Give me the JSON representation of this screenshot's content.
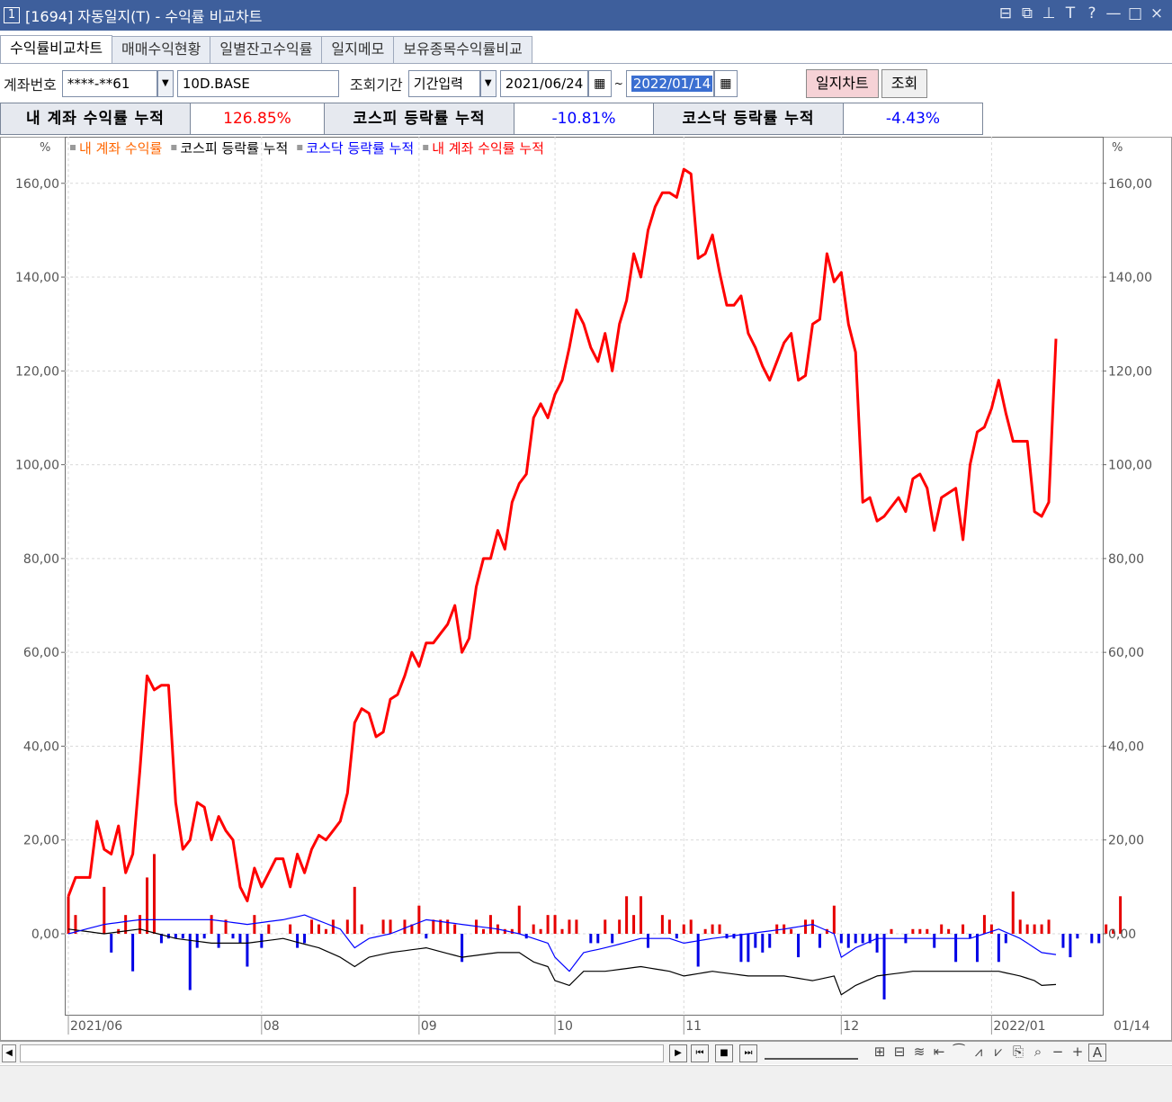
{
  "window": {
    "number": "1",
    "title": "[1694] 자동일지(T) - 수익률 비교차트",
    "tools": [
      "⊟",
      "⧉",
      "⊥",
      "T",
      "?",
      "—",
      "□",
      "×"
    ]
  },
  "tabs": [
    {
      "label": "수익률비교차트",
      "active": true
    },
    {
      "label": "매매수익현황",
      "active": false
    },
    {
      "label": "일별잔고수익률",
      "active": false
    },
    {
      "label": "일지메모",
      "active": false
    },
    {
      "label": "보유종목수익률비교",
      "active": false
    }
  ],
  "toolbar": {
    "account_label": "계좌번호",
    "account_value": "****-**61",
    "account_name": "10D.BASE",
    "period_label": "조회기간",
    "period_mode": "기간입력",
    "start_date": "2021/06/24",
    "tilde": "~",
    "end_date": "2022/01/14",
    "diary_chart_button": "일지차트",
    "query_button": "조회"
  },
  "summary": {
    "my_label": "내 계좌 수익률 누적",
    "my_value": "126.85%",
    "kospi_label": "코스피 등락률 누적",
    "kospi_value": "-10.81%",
    "kosdaq_label": "코스닥 등락률 누적",
    "kosdaq_value": "-4.43%"
  },
  "colors": {
    "my_account": "#ff0000",
    "my_bar_pos": "#e60000",
    "my_bar_neg": "#0000e6",
    "kospi": "#000000",
    "kosdaq": "#0000ff",
    "legend_orange": "#ff6600"
  },
  "chart_data": {
    "type": "line",
    "unit": "%",
    "legend": [
      {
        "name": "내 계좌 수익률",
        "color": "#ff6600",
        "kind": "bar"
      },
      {
        "name": "코스피 등락률 누적",
        "color": "#000000",
        "kind": "line"
      },
      {
        "name": "코스닥 등락률 누적",
        "color": "#0000ff",
        "kind": "line"
      },
      {
        "name": "내 계좌 수익률 누적",
        "color": "#ff0000",
        "kind": "line"
      }
    ],
    "y_ticks": [
      "0,00",
      "20,00",
      "40,00",
      "60,00",
      "80,00",
      "100,00",
      "120,00",
      "140,00",
      "160,00"
    ],
    "ylim": [
      -17,
      166
    ],
    "x_ticks": [
      {
        "label": "2021/06",
        "index": 0
      },
      {
        "label": "08",
        "index": 27
      },
      {
        "label": "09",
        "index": 49
      },
      {
        "label": "10",
        "index": 68
      },
      {
        "label": "11",
        "index": 86
      },
      {
        "label": "12",
        "index": 108
      },
      {
        "label": "2022/01",
        "index": 129
      },
      {
        "label": "01/14",
        "index": 138
      }
    ],
    "n": 139,
    "series": [
      {
        "name": "내 계좌 수익률 누적",
        "color": "#ff0000",
        "anchors": [
          [
            0,
            8
          ],
          [
            1,
            12
          ],
          [
            3,
            12
          ],
          [
            4,
            24
          ],
          [
            5,
            18
          ],
          [
            6,
            17
          ],
          [
            7,
            23
          ],
          [
            8,
            13
          ],
          [
            9,
            17
          ],
          [
            10,
            35
          ],
          [
            11,
            55
          ],
          [
            12,
            52
          ],
          [
            13,
            53
          ],
          [
            14,
            53
          ],
          [
            15,
            28
          ],
          [
            16,
            18
          ],
          [
            17,
            20
          ],
          [
            18,
            28
          ],
          [
            19,
            27
          ],
          [
            20,
            20
          ],
          [
            21,
            25
          ],
          [
            22,
            22
          ],
          [
            23,
            20
          ],
          [
            24,
            10
          ],
          [
            25,
            7
          ],
          [
            26,
            14
          ],
          [
            27,
            10
          ],
          [
            28,
            13
          ],
          [
            29,
            16
          ],
          [
            30,
            16
          ],
          [
            31,
            10
          ],
          [
            32,
            17
          ],
          [
            33,
            13
          ],
          [
            34,
            18
          ],
          [
            35,
            21
          ],
          [
            36,
            20
          ],
          [
            37,
            22
          ],
          [
            38,
            24
          ],
          [
            39,
            30
          ],
          [
            40,
            45
          ],
          [
            41,
            48
          ],
          [
            42,
            47
          ],
          [
            43,
            42
          ],
          [
            44,
            43
          ],
          [
            45,
            50
          ],
          [
            46,
            51
          ],
          [
            47,
            55
          ],
          [
            48,
            60
          ],
          [
            49,
            57
          ],
          [
            50,
            62
          ],
          [
            51,
            62
          ],
          [
            52,
            64
          ],
          [
            53,
            66
          ],
          [
            54,
            70
          ],
          [
            55,
            60
          ],
          [
            56,
            63
          ],
          [
            57,
            74
          ],
          [
            58,
            80
          ],
          [
            59,
            80
          ],
          [
            60,
            86
          ],
          [
            61,
            82
          ],
          [
            62,
            92
          ],
          [
            63,
            96
          ],
          [
            64,
            98
          ],
          [
            65,
            110
          ],
          [
            66,
            113
          ],
          [
            67,
            110
          ],
          [
            68,
            115
          ],
          [
            69,
            118
          ],
          [
            70,
            125
          ],
          [
            71,
            133
          ],
          [
            72,
            130
          ],
          [
            73,
            125
          ],
          [
            74,
            122
          ],
          [
            75,
            128
          ],
          [
            76,
            120
          ],
          [
            77,
            130
          ],
          [
            78,
            135
          ],
          [
            79,
            145
          ],
          [
            80,
            140
          ],
          [
            81,
            150
          ],
          [
            82,
            155
          ],
          [
            83,
            158
          ],
          [
            84,
            158
          ],
          [
            85,
            157
          ],
          [
            86,
            163
          ],
          [
            87,
            162
          ],
          [
            88,
            144
          ],
          [
            89,
            145
          ],
          [
            90,
            149
          ],
          [
            91,
            141
          ],
          [
            92,
            134
          ],
          [
            93,
            134
          ],
          [
            94,
            136
          ],
          [
            95,
            128
          ],
          [
            96,
            125
          ],
          [
            97,
            121
          ],
          [
            98,
            118
          ],
          [
            99,
            122
          ],
          [
            100,
            126
          ],
          [
            101,
            128
          ],
          [
            102,
            118
          ],
          [
            103,
            119
          ],
          [
            104,
            130
          ],
          [
            105,
            131
          ],
          [
            106,
            145
          ],
          [
            107,
            139
          ],
          [
            108,
            141
          ],
          [
            109,
            130
          ],
          [
            110,
            124
          ],
          [
            111,
            92
          ],
          [
            112,
            93
          ],
          [
            113,
            88
          ],
          [
            114,
            89
          ],
          [
            115,
            91
          ],
          [
            116,
            93
          ],
          [
            117,
            90
          ],
          [
            118,
            97
          ],
          [
            119,
            98
          ],
          [
            120,
            95
          ],
          [
            121,
            86
          ],
          [
            122,
            93
          ],
          [
            123,
            94
          ],
          [
            124,
            95
          ],
          [
            125,
            84
          ],
          [
            126,
            100
          ],
          [
            127,
            107
          ],
          [
            128,
            108
          ],
          [
            129,
            112
          ],
          [
            130,
            118
          ],
          [
            131,
            111
          ],
          [
            132,
            105
          ],
          [
            133,
            105
          ],
          [
            134,
            105
          ],
          [
            135,
            90
          ],
          [
            136,
            89
          ],
          [
            137,
            92
          ],
          [
            138,
            126.85
          ]
        ]
      },
      {
        "name": "코스피 등락률 누적",
        "color": "#000000",
        "anchors": [
          [
            0,
            1
          ],
          [
            5,
            0
          ],
          [
            10,
            1
          ],
          [
            15,
            -1
          ],
          [
            20,
            -2
          ],
          [
            25,
            -2
          ],
          [
            30,
            -1
          ],
          [
            35,
            -3
          ],
          [
            38,
            -5
          ],
          [
            40,
            -7
          ],
          [
            42,
            -5
          ],
          [
            45,
            -4
          ],
          [
            50,
            -3
          ],
          [
            55,
            -5
          ],
          [
            60,
            -4
          ],
          [
            63,
            -4
          ],
          [
            65,
            -6
          ],
          [
            67,
            -7
          ],
          [
            68,
            -10
          ],
          [
            70,
            -11
          ],
          [
            72,
            -8
          ],
          [
            75,
            -8
          ],
          [
            80,
            -7
          ],
          [
            84,
            -8
          ],
          [
            86,
            -9
          ],
          [
            90,
            -8
          ],
          [
            95,
            -9
          ],
          [
            100,
            -9
          ],
          [
            104,
            -10
          ],
          [
            107,
            -9
          ],
          [
            108,
            -13
          ],
          [
            110,
            -11
          ],
          [
            113,
            -9
          ],
          [
            118,
            -8
          ],
          [
            122,
            -8
          ],
          [
            126,
            -8
          ],
          [
            130,
            -8
          ],
          [
            133,
            -9
          ],
          [
            135,
            -10
          ],
          [
            136,
            -11
          ],
          [
            138,
            -10.81
          ]
        ]
      },
      {
        "name": "코스닥 등락률 누적",
        "color": "#0000ff",
        "anchors": [
          [
            0,
            0
          ],
          [
            5,
            2
          ],
          [
            10,
            3
          ],
          [
            15,
            3
          ],
          [
            20,
            3
          ],
          [
            25,
            2
          ],
          [
            30,
            3
          ],
          [
            33,
            4
          ],
          [
            38,
            1
          ],
          [
            40,
            -3
          ],
          [
            42,
            -1
          ],
          [
            45,
            0
          ],
          [
            50,
            3
          ],
          [
            55,
            2
          ],
          [
            60,
            1
          ],
          [
            63,
            0
          ],
          [
            65,
            -1
          ],
          [
            67,
            -2
          ],
          [
            68,
            -5
          ],
          [
            70,
            -8
          ],
          [
            72,
            -4
          ],
          [
            75,
            -3
          ],
          [
            80,
            -1
          ],
          [
            84,
            -1
          ],
          [
            86,
            -2
          ],
          [
            90,
            -1
          ],
          [
            95,
            0
          ],
          [
            100,
            1
          ],
          [
            104,
            2
          ],
          [
            107,
            0
          ],
          [
            108,
            -5
          ],
          [
            110,
            -3
          ],
          [
            113,
            -1
          ],
          [
            118,
            -1
          ],
          [
            122,
            -1
          ],
          [
            126,
            -1
          ],
          [
            130,
            1
          ],
          [
            133,
            -1
          ],
          [
            135,
            -3
          ],
          [
            136,
            -4
          ],
          [
            138,
            -4.43
          ]
        ]
      }
    ]
  },
  "chart_bars": {
    "name": "내 계좌 수익률",
    "values": [
      8,
      4,
      0,
      0,
      0,
      10,
      -4,
      1,
      4,
      -8,
      4,
      12,
      17,
      -2,
      -1,
      -1,
      -1,
      -12,
      -3,
      -1,
      4,
      -3,
      3,
      -1,
      -2,
      -7,
      4,
      -3,
      2,
      0,
      0,
      2,
      -3,
      -2,
      3,
      2,
      1,
      3,
      0,
      3,
      10,
      2,
      0,
      0,
      3,
      3,
      0,
      3,
      2,
      6,
      -1,
      3,
      3,
      3,
      2,
      -6,
      0,
      3,
      1,
      4,
      2,
      1,
      1,
      6,
      -1,
      2,
      1,
      4,
      4,
      1,
      3,
      3,
      0,
      -2,
      -2,
      3,
      -2,
      3,
      8,
      4,
      8,
      -3,
      0,
      4,
      3,
      -1,
      2,
      3,
      -7,
      1,
      2,
      2,
      -1,
      -1,
      -6,
      -6,
      -3,
      -4,
      -3,
      2,
      2,
      1,
      -5,
      3,
      3,
      -3,
      1,
      6,
      -2,
      -3,
      -2,
      -2,
      -2,
      -4,
      -14,
      1,
      0,
      -2,
      1,
      1,
      1,
      -3,
      2,
      1,
      -6,
      2,
      -1,
      -6,
      4,
      2,
      -6,
      -2,
      9,
      3,
      2,
      2,
      2,
      3,
      0,
      -3,
      -5,
      -1,
      0,
      -2,
      -2,
      2,
      1,
      8
    ]
  },
  "scroll_icons": [
    "▶",
    "⏮",
    "■",
    "⏭"
  ],
  "chart_tool_icons": [
    "⊞",
    "⊟",
    "≋",
    "⇤",
    "⁀",
    "⩘",
    "⩗",
    "⎘",
    "⌕",
    "−",
    "+",
    "A"
  ]
}
